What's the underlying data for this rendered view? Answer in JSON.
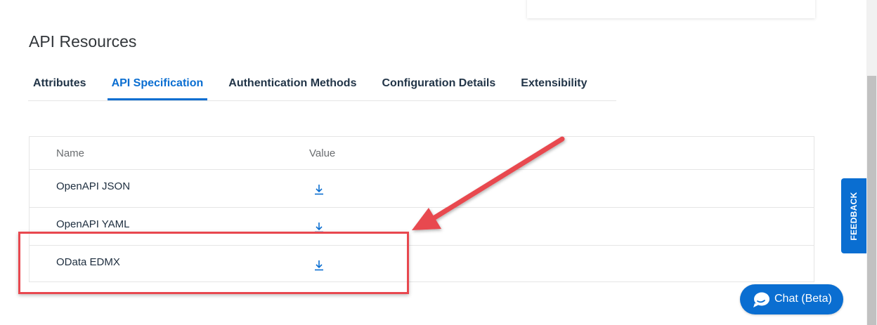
{
  "section": {
    "title": "API Resources"
  },
  "tabs": [
    {
      "label": "Attributes"
    },
    {
      "label": "API Specification"
    },
    {
      "label": "Authentication Methods"
    },
    {
      "label": "Configuration Details"
    },
    {
      "label": "Extensibility"
    }
  ],
  "active_tab": "API Specification",
  "table": {
    "columns": {
      "name": "Name",
      "value": "Value"
    },
    "rows": [
      {
        "name": "OpenAPI JSON",
        "value_icon": "download-icon"
      },
      {
        "name": "OpenAPI YAML",
        "value_icon": "download-icon"
      },
      {
        "name": "OData EDMX",
        "value_icon": "download-icon"
      }
    ]
  },
  "feedback": {
    "label": "FEEDBACK"
  },
  "chat": {
    "label": "Chat (Beta)",
    "icon": "chat-bubble-icon"
  },
  "annotation": {
    "highlighted_row": "OData EDMX",
    "color": "#e8484f"
  },
  "colors": {
    "accent": "#0a6ed1",
    "tab_text": "#223548",
    "annotation": "#e8484f"
  }
}
